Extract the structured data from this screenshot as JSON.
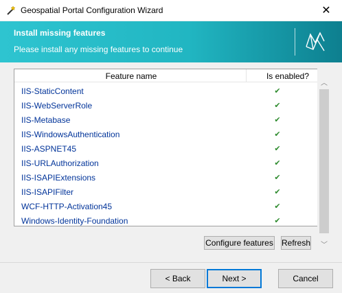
{
  "window": {
    "title": "Geospatial Portal Configuration Wizard",
    "close_glyph": "✕"
  },
  "header": {
    "title": "Install missing features",
    "subtitle": "Please install any missing features to continue",
    "logo_icon": "hexagon-logo-icon",
    "colors": {
      "start": "#2ec4d0",
      "end": "#0d7f8f"
    }
  },
  "table": {
    "columns": [
      "Feature name",
      "Is enabled?"
    ],
    "rows": [
      {
        "name": "IIS-StaticContent",
        "enabled": "✔"
      },
      {
        "name": "IIS-WebServerRole",
        "enabled": "✔"
      },
      {
        "name": "IIS-Metabase",
        "enabled": "✔"
      },
      {
        "name": "IIS-WindowsAuthentication",
        "enabled": "✔"
      },
      {
        "name": "IIS-ASPNET45",
        "enabled": "✔"
      },
      {
        "name": "IIS-URLAuthorization",
        "enabled": "✔"
      },
      {
        "name": "IIS-ISAPIExtensions",
        "enabled": "✔"
      },
      {
        "name": "IIS-ISAPIFilter",
        "enabled": "✔"
      },
      {
        "name": "WCF-HTTP-Activation45",
        "enabled": "✔"
      },
      {
        "name": "Windows-Identity-Foundation",
        "enabled": "✔"
      }
    ]
  },
  "scrollbar": {
    "up_glyph": "︿",
    "down_glyph": "﹀"
  },
  "actions": {
    "configure_label": "Configure features",
    "refresh_label": "Refresh"
  },
  "footer": {
    "back_label": "< Back",
    "next_label": "Next >",
    "cancel_label": "Cancel"
  }
}
